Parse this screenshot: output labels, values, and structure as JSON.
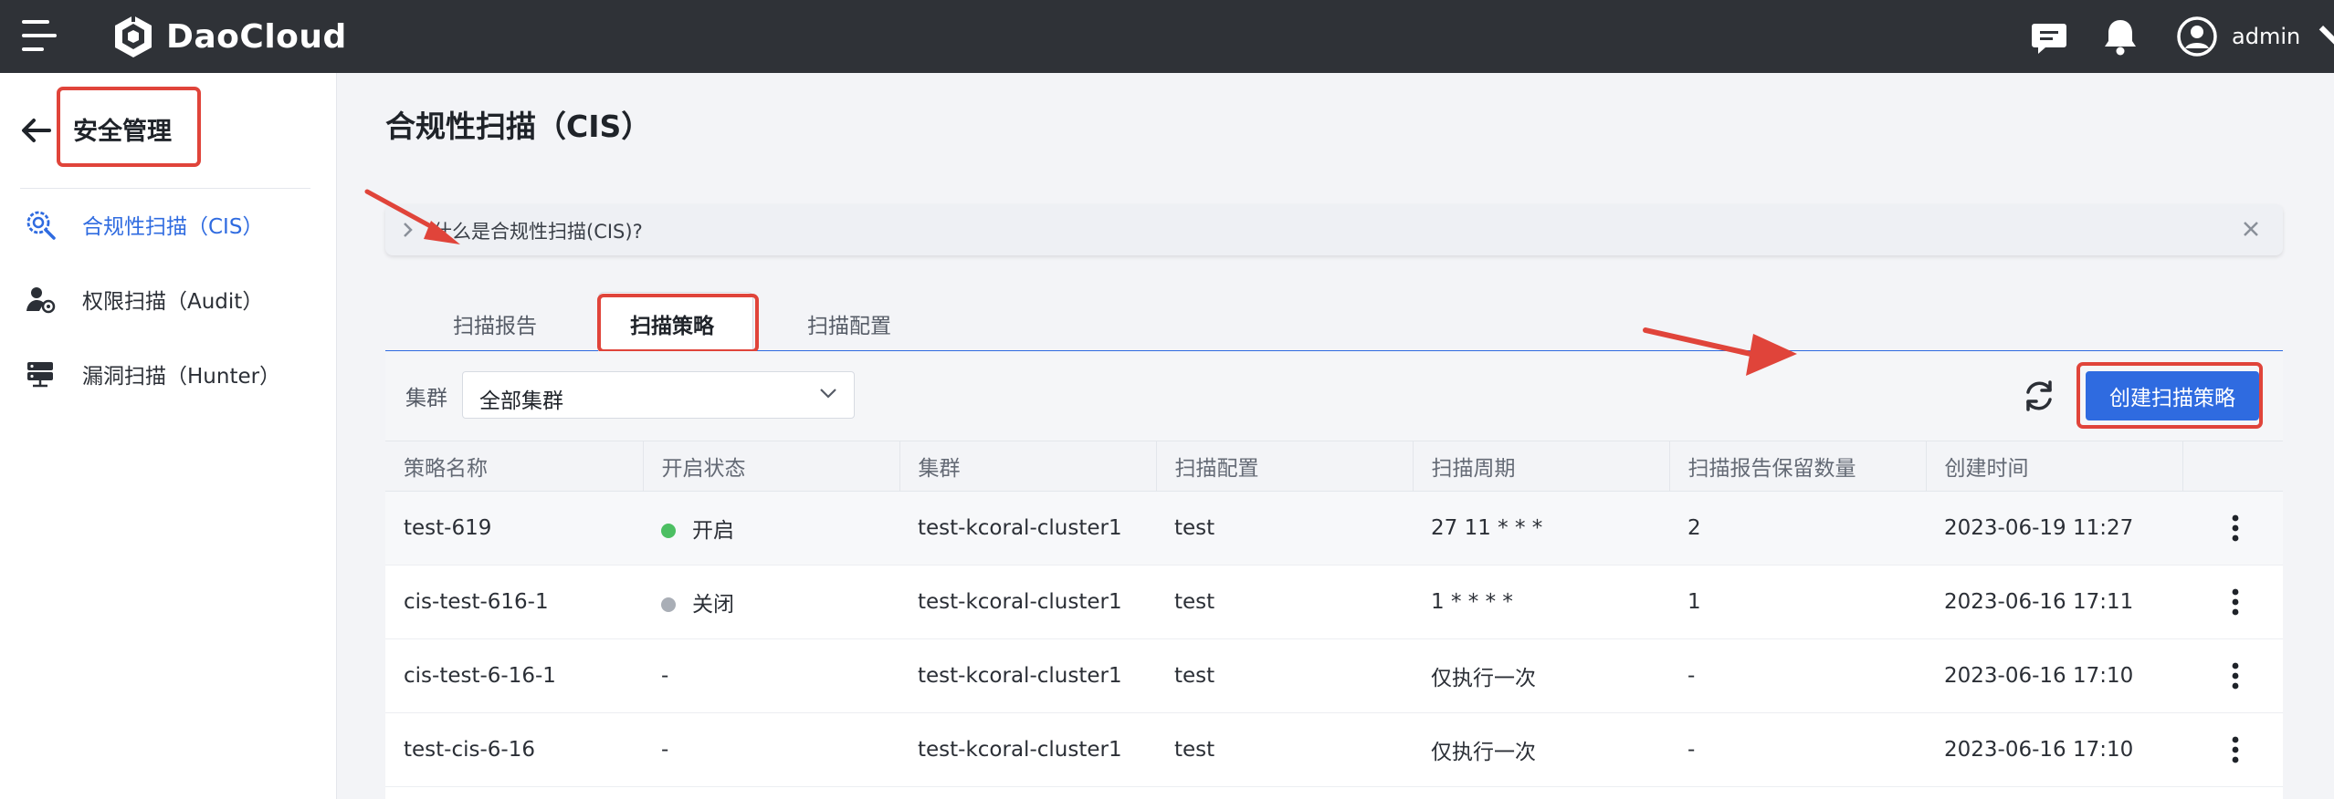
{
  "brand": {
    "name": "DaoCloud"
  },
  "user": {
    "name": "admin"
  },
  "sidebar": {
    "title": "安全管理",
    "items": [
      {
        "label": "合规性扫描（CIS）",
        "icon": "compliance-scan-icon",
        "active": true
      },
      {
        "label": "权限扫描（Audit）",
        "icon": "permission-scan-icon",
        "active": false
      },
      {
        "label": "漏洞扫描（Hunter）",
        "icon": "vulnerability-scan-icon",
        "active": false
      }
    ]
  },
  "page": {
    "title": "合规性扫描（CIS）"
  },
  "info": {
    "text": "什么是合规性扫描(CIS)?"
  },
  "tabs": [
    {
      "label": "扫描报告",
      "active": false
    },
    {
      "label": "扫描策略",
      "active": true
    },
    {
      "label": "扫描配置",
      "active": false
    }
  ],
  "filter": {
    "label": "集群",
    "value": "全部集群"
  },
  "create_button": "创建扫描策略",
  "table": {
    "columns": [
      "策略名称",
      "开启状态",
      "集群",
      "扫描配置",
      "扫描周期",
      "扫描报告保留数量",
      "创建时间"
    ],
    "rows": [
      {
        "name": "test-619",
        "status": "开启",
        "status_color": "#4cbf62",
        "cluster": "test-kcoral-cluster1",
        "config": "test",
        "cycle": "27 11 * * *",
        "retain": "2",
        "created": "2023-06-19 11:27"
      },
      {
        "name": "cis-test-616-1",
        "status": "关闭",
        "status_color": "#a9aeb6",
        "cluster": "test-kcoral-cluster1",
        "config": "test",
        "cycle": "1 * * * *",
        "retain": "1",
        "created": "2023-06-16 17:11"
      },
      {
        "name": "cis-test-6-16-1",
        "status": "-",
        "status_color": "",
        "cluster": "test-kcoral-cluster1",
        "config": "test",
        "cycle": "仅执行一次",
        "retain": "-",
        "created": "2023-06-16 17:10"
      },
      {
        "name": "test-cis-6-16",
        "status": "-",
        "status_color": "",
        "cluster": "test-kcoral-cluster1",
        "config": "test",
        "cycle": "仅执行一次",
        "retain": "-",
        "created": "2023-06-16 17:10"
      }
    ]
  },
  "colors": {
    "accent": "#2f6be0",
    "annotation": "#e0443a",
    "topbar": "#2f3237"
  }
}
